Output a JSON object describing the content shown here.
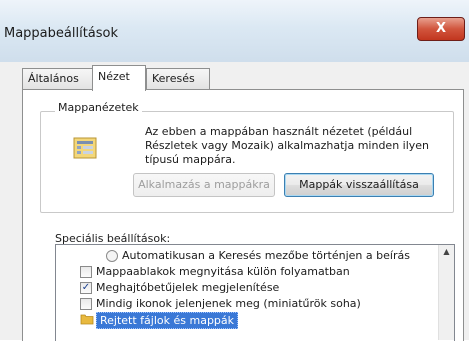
{
  "window": {
    "title": "Mappabeállítások",
    "close_label": "X"
  },
  "tabs": [
    {
      "label": "Általános"
    },
    {
      "label": "Nézet",
      "active": true
    },
    {
      "label": "Keresés"
    }
  ],
  "folder_views": {
    "legend": "Mappanézetek",
    "description": "Az ebben a mappában használt nézetet (például Részletek vagy Mozaik) alkalmazhatja minden ilyen típusú mappára.",
    "apply_button": "Alkalmazás a mappákra",
    "reset_button": "Mappák visszaállítása"
  },
  "advanced": {
    "label": "Speciális beállítások:",
    "items": [
      {
        "type": "radio",
        "label": "Automatikusan a Keresés mezőbe történjen a beírás"
      },
      {
        "type": "checkbox",
        "checked": false,
        "label": "Mappaablakok megnyitása külön folyamatban"
      },
      {
        "type": "checkbox",
        "checked": true,
        "label": "Meghajtóbetűjelek megjelenítése"
      },
      {
        "type": "checkbox",
        "checked": false,
        "label": "Mindig ikonok jelenjenek meg (miniatűrök soha)"
      },
      {
        "type": "folder",
        "selected": true,
        "label": "Rejtett fájlok és mappák"
      }
    ]
  },
  "icons": {
    "close": "close-icon",
    "folder_view": "folder-view-icon",
    "folder": "folder-icon",
    "scroll_up": "scroll-up-arrow-icon"
  },
  "colors": {
    "selection": "#3a78d6",
    "close_button": "#c2361f"
  }
}
